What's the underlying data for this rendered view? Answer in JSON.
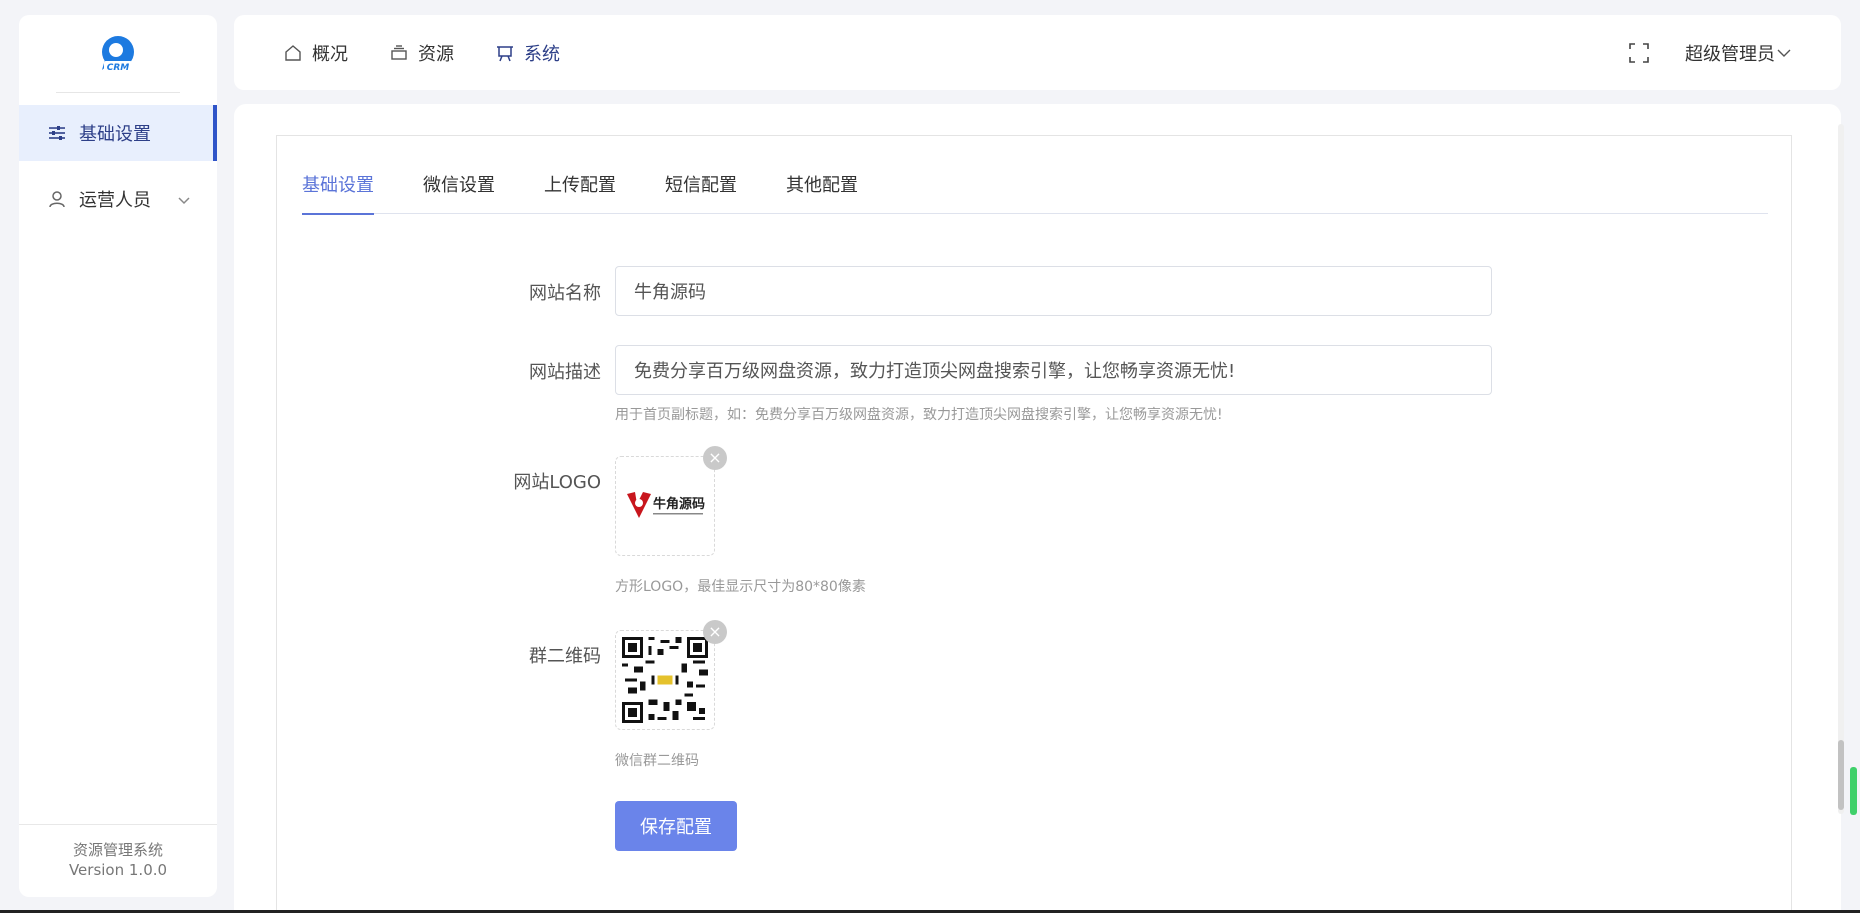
{
  "sidebar": {
    "logo_text": "CRM",
    "items": [
      {
        "label": "基础设置",
        "icon": "sliders-icon",
        "active": true
      },
      {
        "label": "运营人员",
        "icon": "user-icon",
        "expandable": true
      }
    ],
    "footer": {
      "system_name": "资源管理系统",
      "version": "Version 1.0.0"
    }
  },
  "header": {
    "nav": [
      {
        "label": "概况",
        "icon": "home-icon"
      },
      {
        "label": "资源",
        "icon": "layers-icon"
      },
      {
        "label": "系统",
        "icon": "monitor-icon",
        "active": true
      }
    ],
    "user": "超级管理员"
  },
  "tabs": [
    {
      "label": "基础设置",
      "active": true
    },
    {
      "label": "微信设置"
    },
    {
      "label": "上传配置"
    },
    {
      "label": "短信配置"
    },
    {
      "label": "其他配置"
    }
  ],
  "form": {
    "site_name": {
      "label": "网站名称",
      "value": "牛角源码"
    },
    "site_desc": {
      "label": "网站描述",
      "value": "免费分享百万级网盘资源，致力打造顶尖网盘搜索引擎，让您畅享资源无忧!",
      "hint": "用于首页副标题，如：免费分享百万级网盘资源，致力打造顶尖网盘搜索引擎，让您畅享资源无忧!"
    },
    "site_logo": {
      "label": "网站LOGO",
      "logo_text": "牛角源码",
      "hint": "方形LOGO，最佳显示尺寸为80*80像素"
    },
    "qr_code": {
      "label": "群二维码",
      "hint": "微信群二维码"
    },
    "save_label": "保存配置"
  },
  "colors": {
    "accent": "#6a84ea",
    "active_text": "#2d3f88",
    "tab_active": "#5b74d8"
  }
}
